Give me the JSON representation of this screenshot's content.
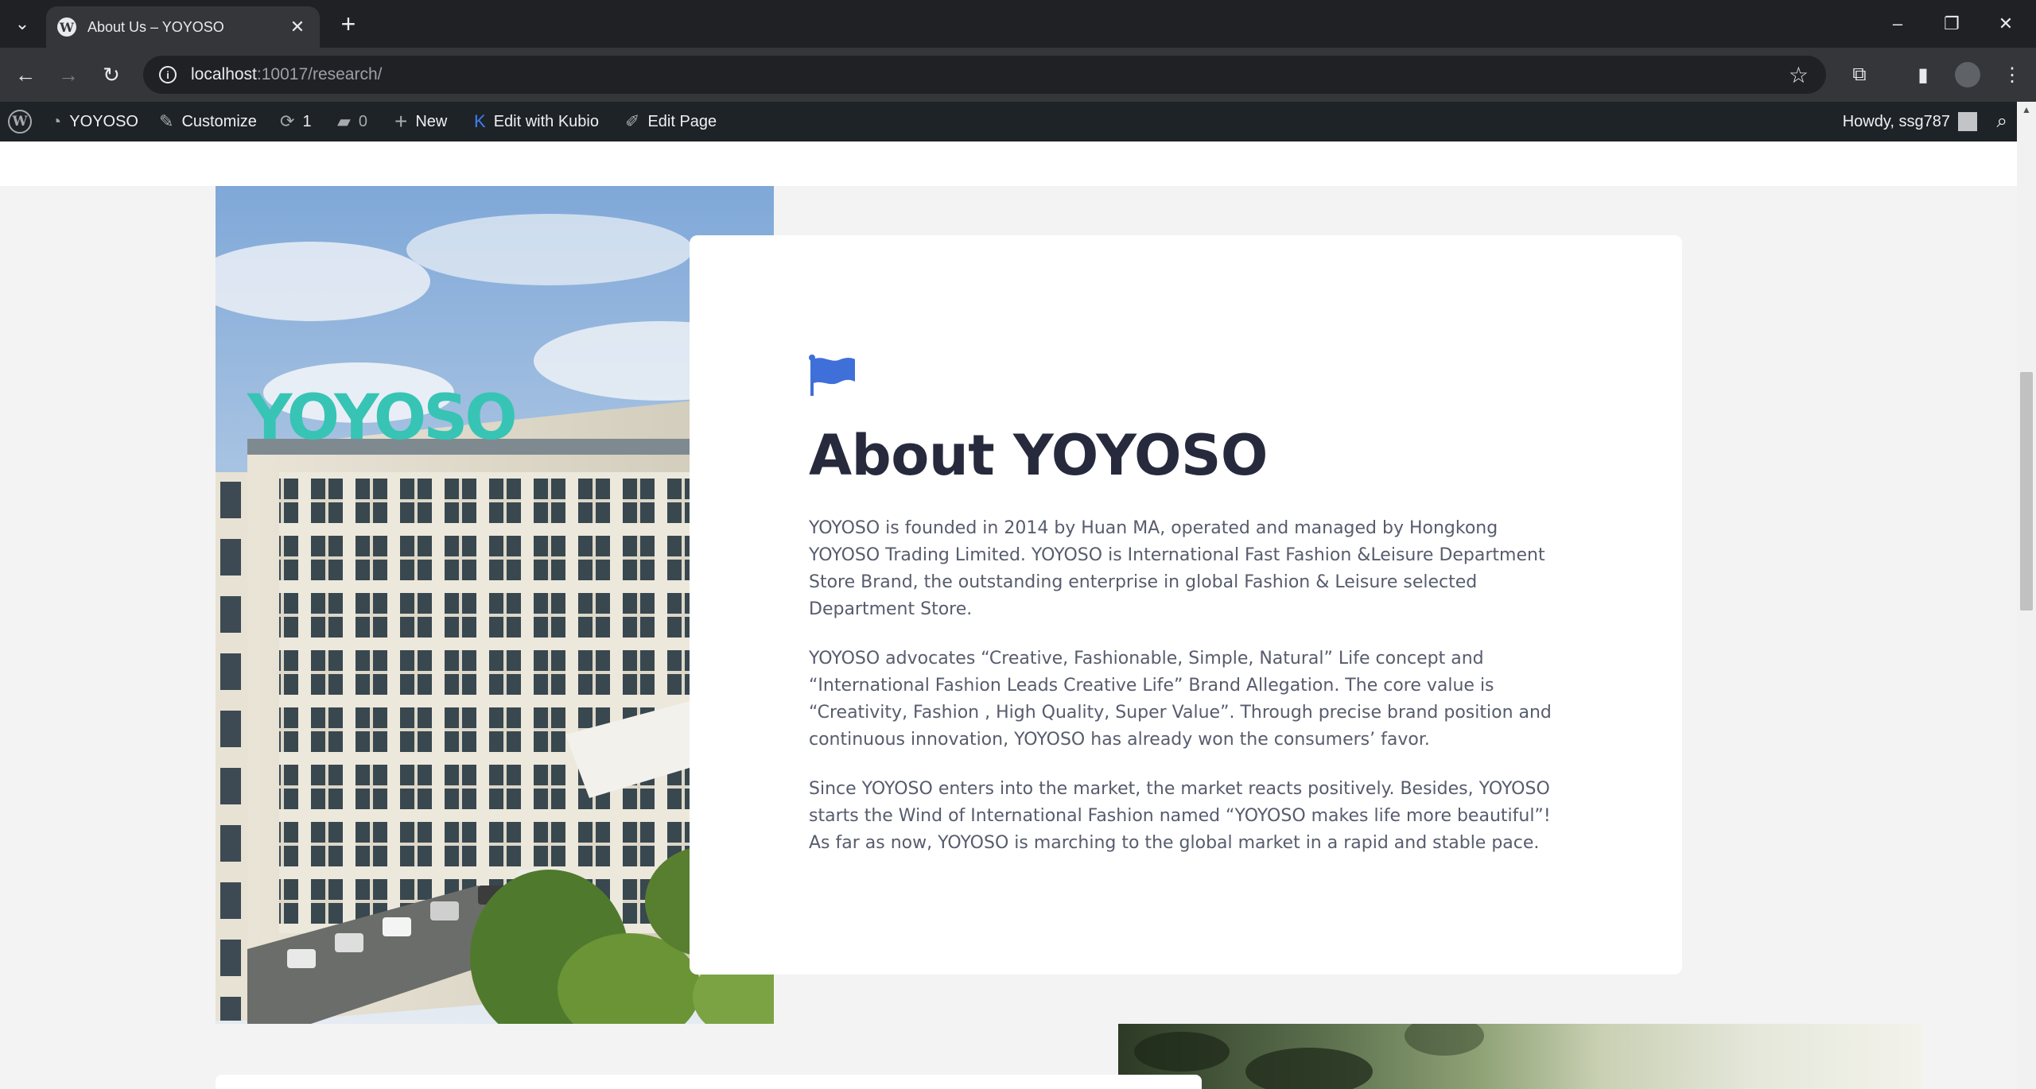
{
  "browser": {
    "tab_title": "About Us – YOYOSO",
    "favicon_letter": "W",
    "url_host": "localhost",
    "url_path": ":10017/research/"
  },
  "adminbar": {
    "site_name": "YOYOSO",
    "customize": "Customize",
    "updates_count": "1",
    "comments_count": "0",
    "new": "New",
    "edit_kubio": "Edit with Kubio",
    "edit_page": "Edit Page",
    "howdy": "Howdy, ssg787"
  },
  "photo": {
    "sign_text": "YOYOSO"
  },
  "about": {
    "title": "About YOYOSO",
    "p1": "YOYOSO is founded in 2014 by Huan MA, operated and managed by Hongkong YOYOSO Trading Limited. YOYOSO is International Fast Fashion &Leisure Department Store Brand, the outstanding enterprise in global Fashion & Leisure selected Department Store.",
    "p2": "YOYOSO advocates “Creative, Fashionable, Simple, Natural” Life concept and “International Fashion Leads Creative Life” Brand Allegation. The core value is “Creativity, Fashion , High Quality, Super Value”. Through precise brand position and continuous innovation, YOYOSO has already won the consumers’ favor.",
    "p3": "Since YOYOSO enters into the market, the market reacts positively. Besides, YOYOSO starts the Wind of International Fashion named “YOYOSO makes life more beautiful”! As far as now, YOYOSO is marching to the global market in a rapid and stable pace."
  },
  "colors": {
    "accent": "#3f6fd8",
    "heading": "#262a3c",
    "body_text": "#575c6d",
    "admin_bar": "#1d2327"
  }
}
